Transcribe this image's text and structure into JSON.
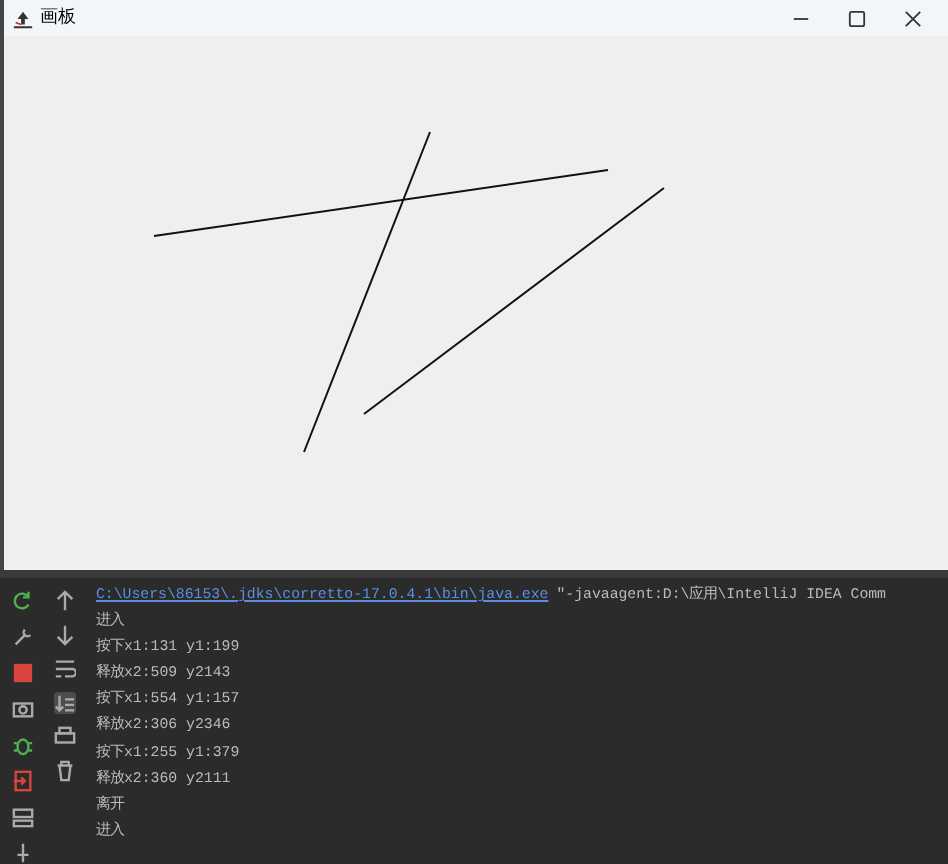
{
  "window": {
    "title": "画板"
  },
  "console": {
    "command_path": "C:\\Users\\86153\\.jdks\\corretto-17.0.4.1\\bin\\java.exe",
    "command_args": "\"-javaagent:D:\\应用\\IntelliJ IDEA Comm",
    "lines": [
      "进入",
      "按下x1:131  y1:199",
      "释放x2:509  y2143",
      "按下x1:554  y1:157",
      "释放x2:306  y2346",
      "按下x1:255  y1:379",
      "释放x2:360  y2111",
      "离开",
      "进入"
    ]
  }
}
